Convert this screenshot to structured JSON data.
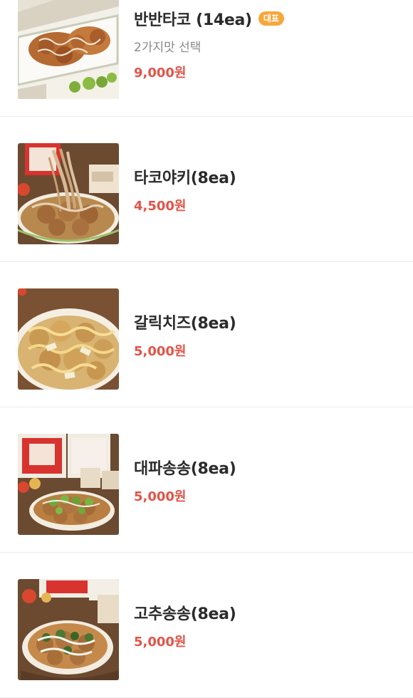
{
  "menu": {
    "items": [
      {
        "name": "반반타코 (14ea)",
        "badge": "대표",
        "description": "2가지맛 선택",
        "price": "9,000원",
        "image_icon": "takoyaki-half-and-half-photo"
      },
      {
        "name": "타코야키(8ea)",
        "price": "4,500원",
        "image_icon": "takoyaki-bonito-flakes-photo"
      },
      {
        "name": "갈릭치즈(8ea)",
        "price": "5,000원",
        "image_icon": "garlic-cheese-takoyaki-photo"
      },
      {
        "name": "대파송송(8ea)",
        "price": "5,000원",
        "image_icon": "green-onion-takoyaki-photo"
      },
      {
        "name": "고추송송(8ea)",
        "price": "5,000원",
        "image_icon": "chili-takoyaki-photo"
      }
    ]
  },
  "colors": {
    "price": "#e25448",
    "badge_bg": "#f7a73a",
    "name": "#2b2b2b",
    "description": "#8a8a8a",
    "divider": "#ececec"
  }
}
